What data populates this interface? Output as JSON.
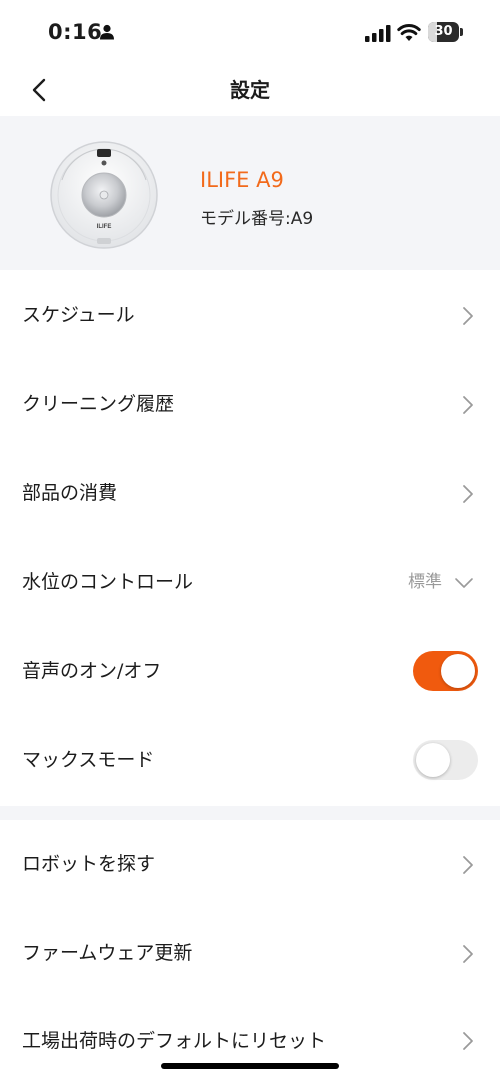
{
  "status_bar": {
    "time": "0:16",
    "battery_level": "30",
    "icons": [
      "person-icon",
      "signal-icon",
      "wifi-icon",
      "battery-icon"
    ]
  },
  "nav": {
    "title": "設定",
    "back_icon": "chevron-left-icon"
  },
  "device": {
    "name": "ILIFE A9",
    "model": "モデル番号:A9",
    "robot_logo": "ILIFE",
    "name_color": "#f26a1b"
  },
  "settings": {
    "schedule": "スケジュール",
    "cleaning_history": "クリーニング履歴",
    "parts_consumption": "部品の消費",
    "water_level": {
      "label": "水位のコントロール",
      "value": "標準"
    },
    "voice": {
      "label": "音声のオン/オフ",
      "enabled": true
    },
    "max_mode": {
      "label": "マックスモード",
      "enabled": false
    },
    "find_robot": "ロボットを探す",
    "firmware_update": "ファームウェア更新",
    "factory_reset": "工場出荷時のデフォルトにリセット"
  },
  "colors": {
    "accent": "#f05a0e",
    "card_background": "#f4f5f8",
    "secondary_text": "#9a9a9a"
  }
}
